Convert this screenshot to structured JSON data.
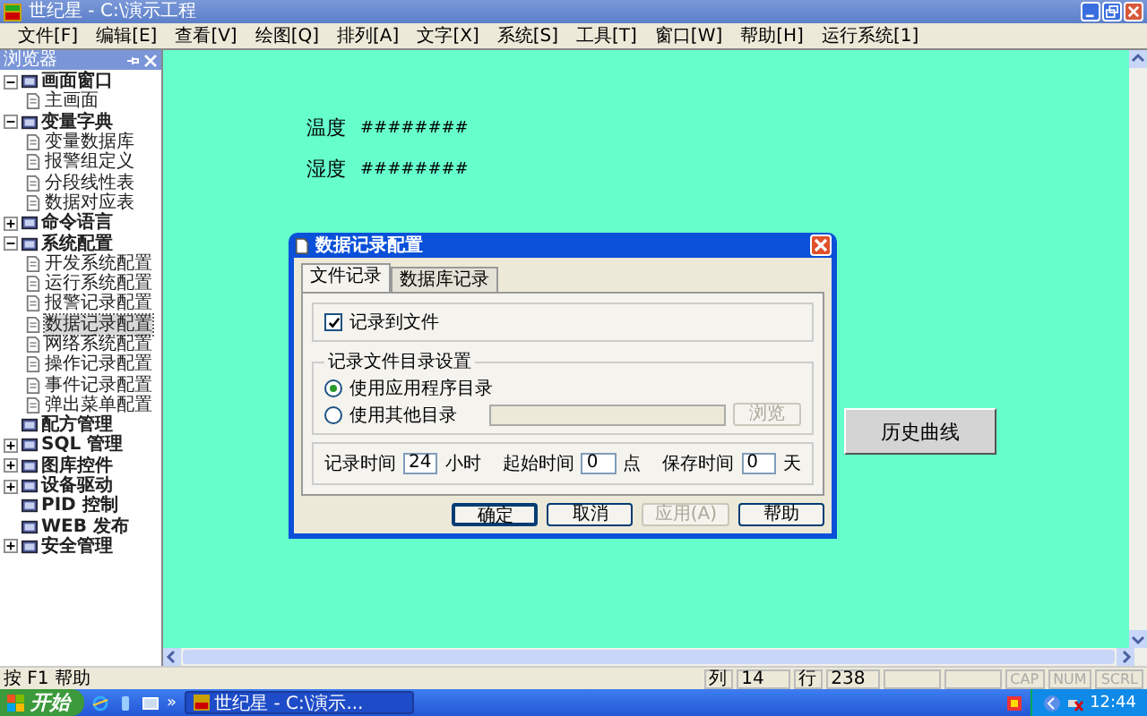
{
  "window": {
    "title": "世纪星 - C:\\演示工程"
  },
  "menu": [
    "文件[F]",
    "编辑[E]",
    "查看[V]",
    "绘图[Q]",
    "排列[A]",
    "文字[X]",
    "系统[S]",
    "工具[T]",
    "窗口[W]",
    "帮助[H]",
    "运行系统[1]"
  ],
  "browser": {
    "title": "浏览器",
    "tree": [
      {
        "label": "画面窗口",
        "expanded": true,
        "selected": false,
        "children": [
          {
            "label": "主画面",
            "selected": false
          }
        ]
      },
      {
        "label": "变量字典",
        "expanded": true,
        "selected": false,
        "children": [
          {
            "label": "变量数据库",
            "selected": false
          },
          {
            "label": "报警组定义",
            "selected": false
          },
          {
            "label": "分段线性表",
            "selected": false
          },
          {
            "label": "数据对应表",
            "selected": false
          }
        ]
      },
      {
        "label": "命令语言",
        "expanded": false,
        "selected": false
      },
      {
        "label": "系统配置",
        "expanded": true,
        "selected": false,
        "children": [
          {
            "label": "开发系统配置",
            "selected": false
          },
          {
            "label": "运行系统配置",
            "selected": false
          },
          {
            "label": "报警记录配置",
            "selected": false
          },
          {
            "label": "数据记录配置",
            "selected": true
          },
          {
            "label": "网络系统配置",
            "selected": false
          },
          {
            "label": "操作记录配置",
            "selected": false
          },
          {
            "label": "事件记录配置",
            "selected": false
          },
          {
            "label": "弹出菜单配置",
            "selected": false
          }
        ]
      },
      {
        "label": "配方管理",
        "selected": false
      },
      {
        "label": "SQL 管理",
        "expanded": false,
        "selected": false
      },
      {
        "label": "图库控件",
        "expanded": false,
        "selected": false
      },
      {
        "label": "设备驱动",
        "expanded": false,
        "selected": false
      },
      {
        "label": "PID 控制",
        "selected": false
      },
      {
        "label": "WEB 发布",
        "selected": false
      },
      {
        "label": "安全管理",
        "expanded": false,
        "selected": false
      }
    ]
  },
  "canvas": {
    "readings": [
      {
        "label": "温度",
        "value": "########"
      },
      {
        "label": "湿度",
        "value": "########"
      }
    ],
    "button": "历史曲线"
  },
  "dialog": {
    "title": "数据记录配置",
    "tabs": [
      {
        "label": "文件记录",
        "selected": true
      },
      {
        "label": "数据库记录",
        "selected": false
      }
    ],
    "record_to_file": {
      "label": "记录到文件",
      "checked": true
    },
    "directory": {
      "title": "记录文件目录设置",
      "options": [
        {
          "label": "使用应用程序目录",
          "selected": true
        },
        {
          "label": "使用其他目录",
          "selected": false
        }
      ],
      "browse": {
        "label": "浏览",
        "disabled": true
      }
    },
    "times": [
      {
        "label": "记录时间",
        "value": "24",
        "unit": "小时"
      },
      {
        "label": "起始时间",
        "value": "0",
        "unit": "点"
      },
      {
        "label": "保存时间",
        "value": "0",
        "unit": "天"
      }
    ],
    "buttons": [
      {
        "label": "确定",
        "disabled": false
      },
      {
        "label": "取消",
        "disabled": false
      },
      {
        "label": "应用(A)",
        "disabled": true
      },
      {
        "label": "帮助",
        "disabled": false
      }
    ]
  },
  "status_bar": {
    "hint": "按 F1 帮助",
    "column_label": "列",
    "column": "14",
    "row_label": "行",
    "row": "238",
    "keys": [
      {
        "label": "CAP",
        "on": false
      },
      {
        "label": "NUM",
        "on": false
      },
      {
        "label": "SCRL",
        "on": false
      }
    ]
  },
  "taskbar": {
    "start": "开始",
    "more": "»",
    "task": "世纪星 - C:\\演示...",
    "clock": "12:44"
  }
}
